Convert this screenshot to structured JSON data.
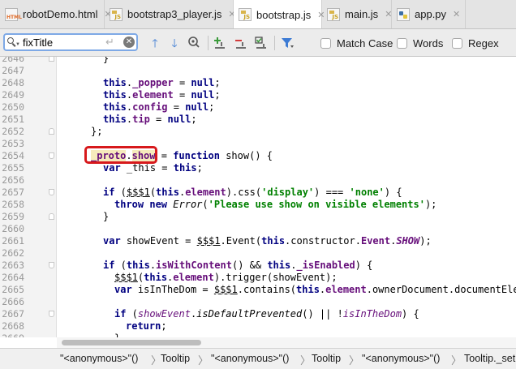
{
  "tabs": [
    {
      "label": "robotDemo.html",
      "icon": "html-file-icon"
    },
    {
      "label": "bootstrap3_player.js",
      "icon": "js-file-icon"
    },
    {
      "label": "bootstrap.js",
      "icon": "js-file-icon",
      "active": true
    },
    {
      "label": "main.js",
      "icon": "js-file-icon"
    },
    {
      "label": "app.py",
      "icon": "python-file-icon"
    }
  ],
  "search": {
    "value": "fixTitle",
    "match_case_label": "Match Case",
    "words_label": "Words",
    "regex_label": "Regex"
  },
  "editor": {
    "line_numbers": [
      "2646",
      "2647",
      "2648",
      "2649",
      "2650",
      "2651",
      "2652",
      "2653",
      "2654",
      "2655",
      "2656",
      "2657",
      "2658",
      "2659",
      "2660",
      "2661",
      "2662",
      "2663",
      "2664",
      "2665",
      "2666",
      "2667",
      "2668",
      "2669"
    ],
    "line_text": {
      "l2646": "}",
      "l2648": "this._popper = null;",
      "l2649": "this.element = null;",
      "l2650": "this.config = null;",
      "l2651": "this.tip = null;",
      "l2652": "};",
      "l2654": "_proto.show = function show() {",
      "l2655": "var _this = this;",
      "l2657": "if ($$$1(this.element).css('display') === 'none') {",
      "l2658": "throw new Error('Please use show on visible elements');",
      "l2659": "}",
      "l2661": "var showEvent = $$$1.Event(this.constructor.Event.SHOW);",
      "l2663": "if (this.isWithContent() && this._isEnabled) {",
      "l2664": "$$$1(this.element).trigger(showEvent);",
      "l2665": "var isInTheDom = $$$1.contains(this.element.ownerDocument.documentEleme",
      "l2667": "if (showEvent.isDefaultPrevented() || !isInTheDom) {",
      "l2668": "return;",
      "l2669": "}"
    },
    "t": {
      "this": "this",
      "null": "null",
      "semi": ";",
      "dot": ".",
      "eq": " = ",
      "popper": "_popper",
      "element": "element",
      "config": "config",
      "tip": "tip",
      "proto": "_proto",
      "show": "show",
      "function": "function",
      "show_sig": " show() {",
      "var": "var",
      "_this": "_this",
      "if": "if",
      "throw": "throw",
      "new": "new",
      "Error": "Error",
      "msg": "'Please use show on visible elements'",
      "display": "'display'",
      "none": "'none'",
      "$$$1": "$$$1",
      "showEvent": "showEvent",
      "Event": "Event",
      "SHOW": "SHOW",
      "isWithContent": "isWithContent",
      "_isEnabled": "_isEnabled",
      "isInTheDom": "isInTheDom",
      "isDefaultPrevented": "isDefaultPrevented",
      "return": "return"
    }
  },
  "breadcrumb": [
    "\"<anonymous>\"()",
    "Tooltip",
    "\"<anonymous>\"()",
    "Tooltip",
    "\"<anonymous>\"()",
    "Tooltip._set"
  ],
  "colors": {
    "keyword": "#000080",
    "field": "#660e7a",
    "string": "#008000",
    "highlight_box": "#d7191c"
  }
}
